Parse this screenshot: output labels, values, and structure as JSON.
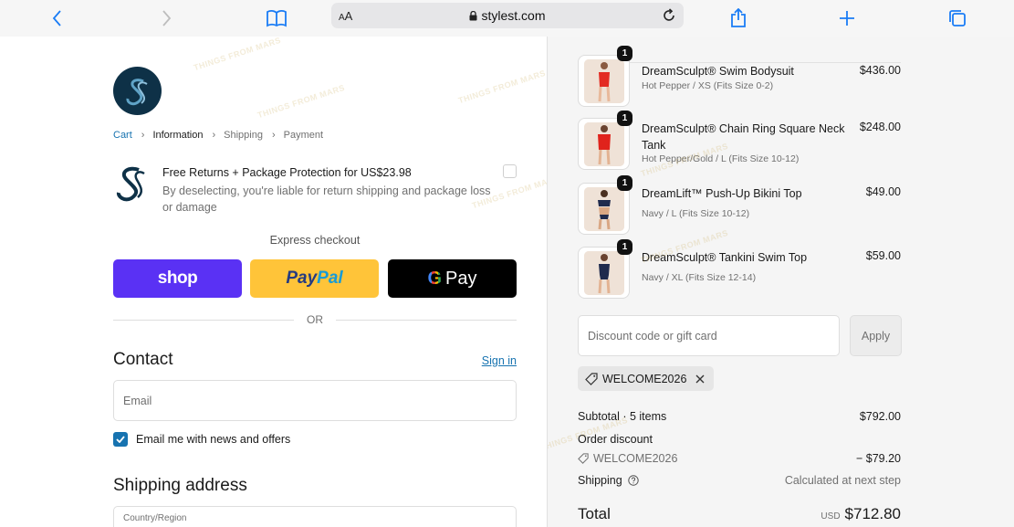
{
  "browser": {
    "text_size_label": "AA",
    "url": "stylest.com"
  },
  "watermark": "THINGS FROM MARS",
  "checkout": {
    "breadcrumb": [
      "Cart",
      "Information",
      "Shipping",
      "Payment"
    ],
    "protection": {
      "title": "Free Returns + Package Protection for US$23.98",
      "description": "By deselecting, you're liable for return shipping and package loss or damage"
    },
    "express_label": "Express checkout",
    "pay_buttons": {
      "shop": "shop",
      "paypal_part1": "Pay",
      "paypal_part2": "Pal",
      "gpay_g": "G",
      "gpay_text": "Pay"
    },
    "or_label": "OR",
    "contact_heading": "Contact",
    "sign_in": "Sign in",
    "email_placeholder": "Email",
    "news_label": "Email me with news and offers",
    "shipping_heading": "Shipping address",
    "country_label": "Country/Region"
  },
  "summary": {
    "items": [
      {
        "qty": "1",
        "name": "DreamSculpt® Swim Bodysuit",
        "variant": "Hot Pepper / XS (Fits Size 0-2)",
        "price": "$436.00"
      },
      {
        "qty": "1",
        "name": "DreamSculpt® Chain Ring Square Neck Tank",
        "variant": "Hot Pepper/Gold / L (Fits Size 10-12)",
        "price": "$248.00"
      },
      {
        "qty": "1",
        "name": "DreamLift™ Push-Up Bikini Top",
        "variant": "Navy / L (Fits Size 10-12)",
        "price": "$49.00"
      },
      {
        "qty": "1",
        "name": "DreamSculpt® Tankini Swim Top",
        "variant": "Navy / XL (Fits Size 12-14)",
        "price": "$59.00"
      }
    ],
    "discount_placeholder": "Discount code or gift card",
    "apply_label": "Apply",
    "applied_code": "WELCOME2026",
    "subtotal_label": "Subtotal · 5 items",
    "subtotal_value": "$792.00",
    "order_discount_label": "Order discount",
    "discount_code": "WELCOME2026",
    "discount_value": "− $79.20",
    "shipping_label": "Shipping",
    "shipping_value": "Calculated at next step",
    "total_label": "Total",
    "currency": "USD",
    "total_value": "$712.80"
  }
}
